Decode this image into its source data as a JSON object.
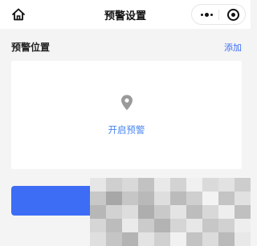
{
  "navbar": {
    "title": "预警设置",
    "home_icon": "home-icon",
    "more_icon": "more-dots-icon",
    "close_icon": "target-close-icon"
  },
  "section": {
    "title": "预警位置",
    "add_label": "添加"
  },
  "card": {
    "icon": "location-pin-icon",
    "enable_label": "开启预警"
  },
  "bottom_button": {
    "label": ""
  },
  "colors": {
    "accent": "#3e6ef5",
    "link": "#4a86f0",
    "background": "#f4f4f4",
    "card": "#ffffff",
    "icon_gray": "#9a9a9a"
  }
}
